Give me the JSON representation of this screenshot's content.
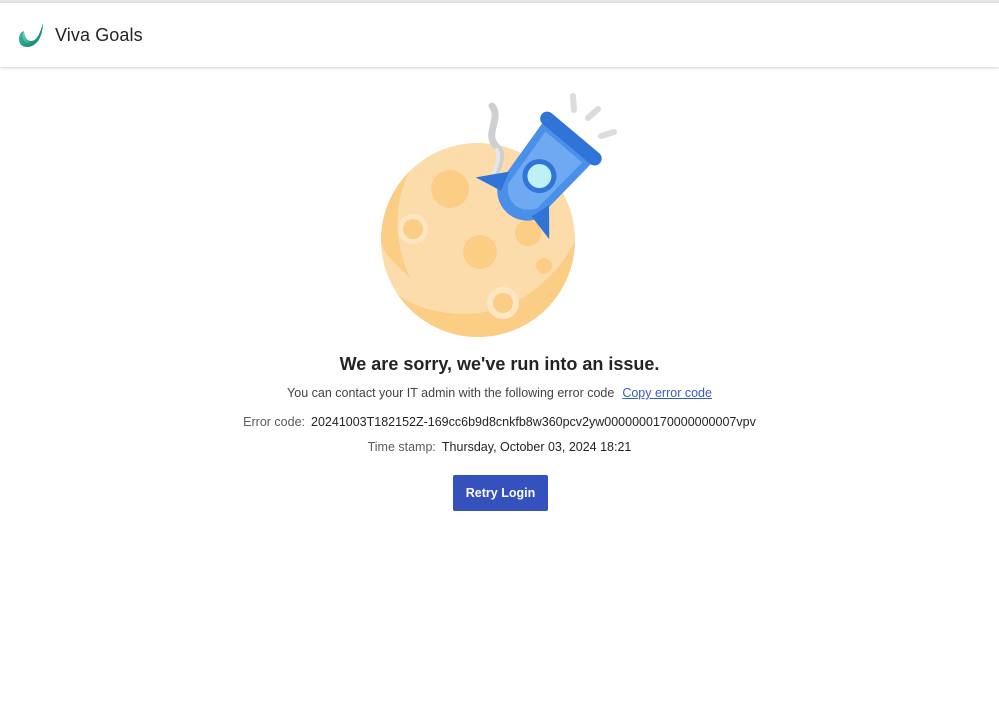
{
  "header": {
    "app_title": "Viva Goals",
    "logo_icon": "viva-goals-logo-icon"
  },
  "main": {
    "illustration_icon": "moon-rocket-crash-illustration",
    "heading": "We are sorry, we've run into an issue.",
    "contact_text": "You can contact your IT admin with the following error code",
    "copy_link_label": "Copy error code",
    "error_code_label": "Error code:",
    "error_code_value": "20241003T182152Z-169cc6b9d8cnkfb8w360pcv2yw0000000170000000007vpv",
    "timestamp_label": "Time stamp:",
    "timestamp_value": "Thursday, October 03, 2024 18:21",
    "retry_button_label": "Retry Login"
  },
  "colors": {
    "primary_button": "#3551be",
    "link": "#3b5bc4",
    "moon": "#fddcab",
    "rocket": "#4a8fe8"
  }
}
